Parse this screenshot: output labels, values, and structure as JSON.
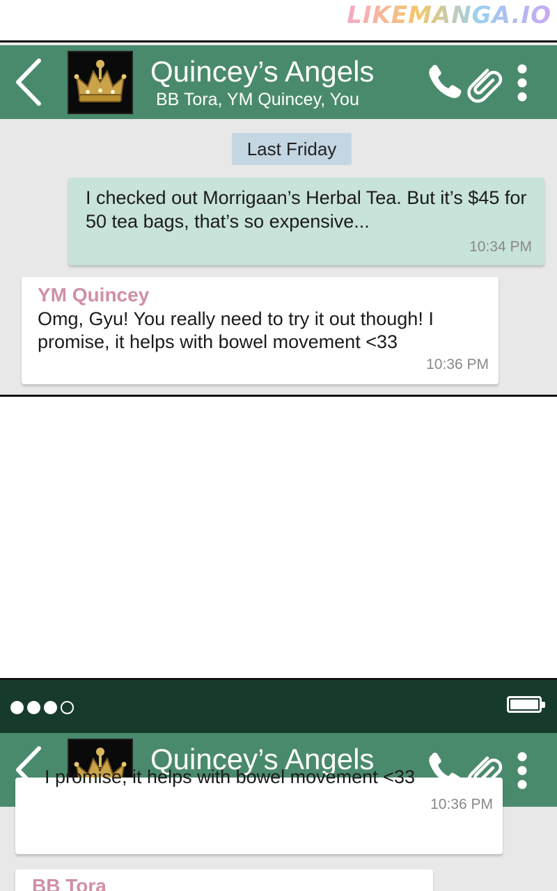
{
  "watermark": "LIKEMANGA.IO",
  "chat": {
    "title": "Quincey’s Angels",
    "members": "BB Tora, YM Quincey, You",
    "avatar_icon": "crown-icon",
    "header_color": "#4a8a6c"
  },
  "panel1": {
    "date_label": "Last Friday",
    "messages": [
      {
        "direction": "outgoing",
        "text": "I checked out Morrigaan’s Herbal Tea. But it’s $45 for 50 tea bags, that’s so expensive...",
        "time": "10:34 PM"
      },
      {
        "direction": "incoming",
        "sender": "YM Quincey",
        "text": "Omg, Gyu! You really need to try it out though! I promise, it helps with bowel movement <33",
        "time": "10:36 PM"
      }
    ]
  },
  "panel2": {
    "status": {
      "signal_filled": 3,
      "signal_total": 4,
      "battery_level": 1.0
    },
    "messages": [
      {
        "direction": "incoming",
        "text_partial": "I promise, it helps with bowel movement <33",
        "time": "10:36 PM"
      },
      {
        "direction": "incoming",
        "sender": "BB Tora"
      }
    ]
  },
  "colors": {
    "status_bar": "#163b2c",
    "outgoing_bubble": "#c8e3d9",
    "incoming_bubble": "#ffffff",
    "sender_name": "#cf8fa8",
    "date_chip": "#c4d6e2",
    "chat_bg": "#e8e8e8"
  }
}
